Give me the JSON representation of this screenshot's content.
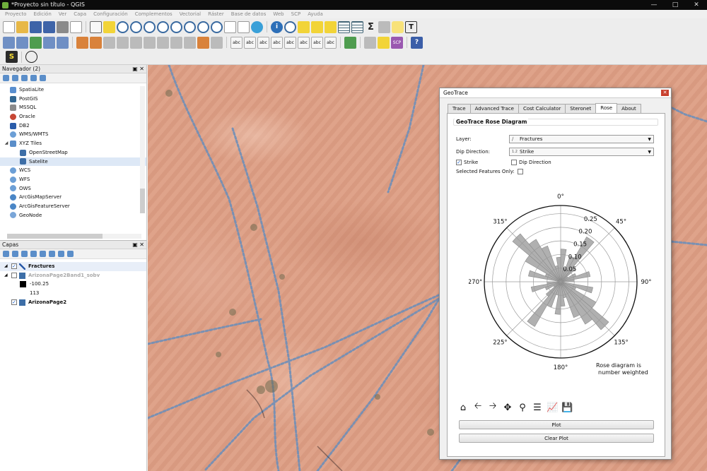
{
  "window": {
    "title": "*Proyecto sin título - QGIS"
  },
  "menu": [
    "Proyecto",
    "Edición",
    "Ver",
    "Capa",
    "Configuración",
    "Complementos",
    "Vectorial",
    "Ráster",
    "Base de datos",
    "Web",
    "SCP",
    "Ayuda"
  ],
  "toolbar": {
    "scp_label": "SCP",
    "s_label": "S",
    "sum_label": "Σ",
    "text_label": "T",
    "info_label": "i",
    "help_label": "?"
  },
  "navigator": {
    "title": "Navegador (2)",
    "items": [
      {
        "label": "SpatiaLite"
      },
      {
        "label": "PostGIS"
      },
      {
        "label": "MSSQL"
      },
      {
        "label": "Oracle"
      },
      {
        "label": "DB2"
      },
      {
        "label": "WMS/WMTS"
      },
      {
        "label": "XYZ Tiles"
      },
      {
        "label": "OpenStreetMap"
      },
      {
        "label": "Satelite"
      },
      {
        "label": "WCS"
      },
      {
        "label": "WFS"
      },
      {
        "label": "OWS"
      },
      {
        "label": "ArcGisMapServer"
      },
      {
        "label": "ArcGisFeatureServer"
      },
      {
        "label": "GeoNode"
      }
    ]
  },
  "layers": {
    "title": "Capas",
    "items": [
      {
        "label": "Fractures",
        "checked": true
      },
      {
        "label": "ArizonaPage2Band1_sobv",
        "checked": false
      },
      {
        "label": "-100.25"
      },
      {
        "label": "113"
      },
      {
        "label": "ArizonaPage2",
        "checked": true
      }
    ]
  },
  "geotrace": {
    "title": "GeoTrace",
    "tabs": [
      "Trace",
      "Advanced Trace",
      "Cost Calculator",
      "Steronet",
      "Rose",
      "About"
    ],
    "active_tab": "Rose",
    "group_title": "GeoTrace Rose Diagram",
    "layer_label": "Layer:",
    "layer_value": "Fractures",
    "dip_label": "Dip Direction:",
    "dip_value": "Strike",
    "strike_label": "Strike",
    "dipdir_label": "Dip Direction",
    "selected_label": "Selected Features Only:",
    "plot_button": "Plot",
    "clear_button": "Clear Plot",
    "note_line1": "Rose diagram is",
    "note_line2": "number weighted"
  },
  "chart_data": {
    "type": "rose",
    "angle_labels": [
      "0°",
      "45°",
      "90°",
      "135°",
      "180°",
      "225°",
      "270°",
      "315°"
    ],
    "radial_ticks": [
      0.05,
      0.1,
      0.15,
      0.2,
      0.25
    ],
    "radial_tick_labels": [
      "0.05",
      "0.10",
      "0.15",
      "0.20",
      "0.25"
    ],
    "rmax": 0.28,
    "bin_width_deg": 10,
    "bins": [
      {
        "angle": 5,
        "value": 0.12
      },
      {
        "angle": 15,
        "value": 0.05
      },
      {
        "angle": 25,
        "value": 0.1
      },
      {
        "angle": 35,
        "value": 0.19
      },
      {
        "angle": 45,
        "value": 0.07
      },
      {
        "angle": 55,
        "value": 0.03
      },
      {
        "angle": 65,
        "value": 0.06
      },
      {
        "angle": 75,
        "value": 0.11
      },
      {
        "angle": 85,
        "value": 0.05
      },
      {
        "angle": 285,
        "value": 0.12
      },
      {
        "angle": 295,
        "value": 0.06
      },
      {
        "angle": 305,
        "value": 0.15
      },
      {
        "angle": 315,
        "value": 0.23
      },
      {
        "angle": 325,
        "value": 0.18
      },
      {
        "angle": 335,
        "value": 0.14
      },
      {
        "angle": 345,
        "value": 0.06
      },
      {
        "angle": 355,
        "value": 0.09
      }
    ],
    "bar_color": "#b0b0b0",
    "grid": true
  }
}
